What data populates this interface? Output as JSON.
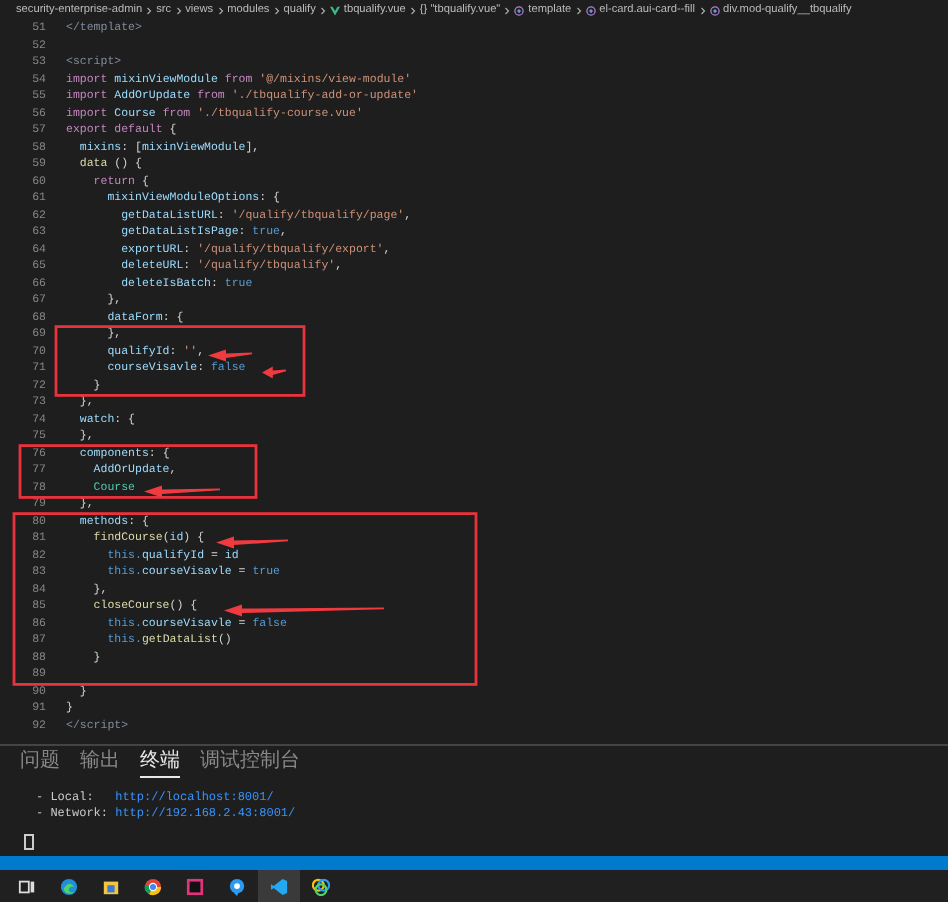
{
  "breadcrumb": [
    {
      "text": "security-enterprise-admin",
      "kind": "folder"
    },
    {
      "text": "src",
      "kind": "folder"
    },
    {
      "text": "views",
      "kind": "folder"
    },
    {
      "text": "modules",
      "kind": "folder"
    },
    {
      "text": "qualify",
      "kind": "folder"
    },
    {
      "text": "tbqualify.vue",
      "kind": "vue-file"
    },
    {
      "text": "{} \"tbqualify.vue\"",
      "kind": "folder"
    },
    {
      "text": "template",
      "kind": "element"
    },
    {
      "text": "el-card.aui-card--fill",
      "kind": "element"
    },
    {
      "text": "div.mod-qualify__tbqualify",
      "kind": "element"
    }
  ],
  "editor": {
    "lines": [
      {
        "number": "51",
        "tokens": [
          {
            "text": "</template>",
            "kind": "tag"
          }
        ]
      },
      {
        "number": "52"
      },
      {
        "number": "53",
        "tokens": [
          {
            "text": "<script>",
            "kind": "tag"
          }
        ]
      },
      {
        "number": "54",
        "tokens": [
          {
            "text": "import",
            "kind": "keyword"
          },
          {
            "text": " mixinViewModule ",
            "kind": "ident"
          },
          {
            "text": "from",
            "kind": "keyword"
          },
          {
            "text": " '@/mixins/view-module'",
            "kind": "string"
          }
        ]
      },
      {
        "number": "55",
        "tokens": [
          {
            "text": "import",
            "kind": "keyword"
          },
          {
            "text": " AddOrUpdate ",
            "kind": "ident"
          },
          {
            "text": "from",
            "kind": "keyword"
          },
          {
            "text": " './tbqualify-add-or-update'",
            "kind": "string"
          }
        ]
      },
      {
        "number": "56",
        "tokens": [
          {
            "text": "import",
            "kind": "keyword"
          },
          {
            "text": " Course ",
            "kind": "ident"
          },
          {
            "text": "from",
            "kind": "keyword"
          },
          {
            "text": " './tbqualify-course.vue'",
            "kind": "string"
          }
        ]
      },
      {
        "number": "57",
        "tokens": [
          {
            "text": "export default",
            "kind": "keyword"
          },
          {
            "text": " {",
            "kind": "punct"
          }
        ]
      },
      {
        "number": "58",
        "tokens": [
          {
            "text": "  mixins",
            "kind": "ident"
          },
          {
            "text": ": [",
            "kind": "punct"
          },
          {
            "text": "mixinViewModule",
            "kind": "ident"
          },
          {
            "text": "],",
            "kind": "punct"
          }
        ]
      },
      {
        "number": "59",
        "tokens": [
          {
            "text": "  data",
            "kind": "func"
          },
          {
            "text": " () {",
            "kind": "punct"
          }
        ]
      },
      {
        "number": "60",
        "tokens": [
          {
            "text": "    return",
            "kind": "keyword"
          },
          {
            "text": " {",
            "kind": "punct"
          }
        ]
      },
      {
        "number": "61",
        "tokens": [
          {
            "text": "      mixinViewModuleOptions",
            "kind": "ident"
          },
          {
            "text": ": {",
            "kind": "punct"
          }
        ]
      },
      {
        "number": "62",
        "tokens": [
          {
            "text": "        getDataListURL",
            "kind": "ident"
          },
          {
            "text": ": ",
            "kind": "punct"
          },
          {
            "text": "'/qualify/tbqualify/page'",
            "kind": "string"
          },
          {
            "text": ",",
            "kind": "punct"
          }
        ]
      },
      {
        "number": "63",
        "tokens": [
          {
            "text": "        getDataListIsPage",
            "kind": "ident"
          },
          {
            "text": ": ",
            "kind": "punct"
          },
          {
            "text": "true",
            "kind": "literal"
          },
          {
            "text": ",",
            "kind": "punct"
          }
        ]
      },
      {
        "number": "64",
        "tokens": [
          {
            "text": "        exportURL",
            "kind": "ident"
          },
          {
            "text": ": ",
            "kind": "punct"
          },
          {
            "text": "'/qualify/tbqualify/export'",
            "kind": "string"
          },
          {
            "text": ",",
            "kind": "punct"
          }
        ]
      },
      {
        "number": "65",
        "tokens": [
          {
            "text": "        deleteURL",
            "kind": "ident"
          },
          {
            "text": ": ",
            "kind": "punct"
          },
          {
            "text": "'/qualify/tbqualify'",
            "kind": "string"
          },
          {
            "text": ",",
            "kind": "punct"
          }
        ]
      },
      {
        "number": "66",
        "tokens": [
          {
            "text": "        deleteIsBatch",
            "kind": "ident"
          },
          {
            "text": ": ",
            "kind": "punct"
          },
          {
            "text": "true",
            "kind": "literal"
          }
        ]
      },
      {
        "number": "67",
        "tokens": [
          {
            "text": "      },",
            "kind": "punct"
          }
        ]
      },
      {
        "number": "68",
        "tokens": [
          {
            "text": "      dataForm",
            "kind": "ident"
          },
          {
            "text": ": {",
            "kind": "punct"
          }
        ]
      },
      {
        "number": "69",
        "tokens": [
          {
            "text": "      },",
            "kind": "punct"
          }
        ]
      },
      {
        "number": "70",
        "tokens": [
          {
            "text": "      qualifyId",
            "kind": "ident"
          },
          {
            "text": ": ",
            "kind": "punct"
          },
          {
            "text": "''",
            "kind": "string"
          },
          {
            "text": ",",
            "kind": "punct"
          }
        ]
      },
      {
        "number": "71",
        "tokens": [
          {
            "text": "      courseVisavle",
            "kind": "ident"
          },
          {
            "text": ": ",
            "kind": "punct"
          },
          {
            "text": "false",
            "kind": "literal"
          }
        ]
      },
      {
        "number": "72",
        "tokens": [
          {
            "text": "    }",
            "kind": "punct"
          }
        ]
      },
      {
        "number": "73",
        "tokens": [
          {
            "text": "  },",
            "kind": "punct"
          }
        ]
      },
      {
        "number": "74",
        "tokens": [
          {
            "text": "  watch",
            "kind": "ident"
          },
          {
            "text": ": {",
            "kind": "punct"
          }
        ]
      },
      {
        "number": "75",
        "tokens": [
          {
            "text": "  },",
            "kind": "punct"
          }
        ]
      },
      {
        "number": "76",
        "tokens": [
          {
            "text": "  components",
            "kind": "ident"
          },
          {
            "text": ": {",
            "kind": "punct"
          }
        ]
      },
      {
        "number": "77",
        "tokens": [
          {
            "text": "    AddOrUpdate",
            "kind": "ident"
          },
          {
            "text": ",",
            "kind": "punct"
          }
        ]
      },
      {
        "number": "78",
        "tokens": [
          {
            "text": "    Course",
            "kind": "class"
          }
        ]
      },
      {
        "number": "79",
        "tokens": [
          {
            "text": "  },",
            "kind": "punct"
          }
        ]
      },
      {
        "number": "80",
        "tokens": [
          {
            "text": "  methods",
            "kind": "ident"
          },
          {
            "text": ": {",
            "kind": "punct"
          }
        ]
      },
      {
        "number": "81",
        "tokens": [
          {
            "text": "    findCourse",
            "kind": "func"
          },
          {
            "text": "(",
            "kind": "punct"
          },
          {
            "text": "id",
            "kind": "ident"
          },
          {
            "text": ") {",
            "kind": "punct"
          }
        ]
      },
      {
        "number": "82",
        "tokens": [
          {
            "text": "      this.",
            "kind": "literal"
          },
          {
            "text": "qualifyId",
            "kind": "ident"
          },
          {
            "text": " = ",
            "kind": "punct"
          },
          {
            "text": "id",
            "kind": "ident"
          }
        ]
      },
      {
        "number": "83",
        "tokens": [
          {
            "text": "      this.",
            "kind": "literal"
          },
          {
            "text": "courseVisavle",
            "kind": "ident"
          },
          {
            "text": " = ",
            "kind": "punct"
          },
          {
            "text": "true",
            "kind": "literal"
          }
        ]
      },
      {
        "number": "84",
        "tokens": [
          {
            "text": "    },",
            "kind": "punct"
          }
        ]
      },
      {
        "number": "85",
        "tokens": [
          {
            "text": "    closeCourse",
            "kind": "func"
          },
          {
            "text": "() {",
            "kind": "punct"
          }
        ]
      },
      {
        "number": "86",
        "tokens": [
          {
            "text": "      this.",
            "kind": "literal"
          },
          {
            "text": "courseVisavle",
            "kind": "ident"
          },
          {
            "text": " = ",
            "kind": "punct"
          },
          {
            "text": "false",
            "kind": "literal"
          }
        ]
      },
      {
        "number": "87",
        "tokens": [
          {
            "text": "      this.",
            "kind": "literal"
          },
          {
            "text": "getDataList",
            "kind": "func"
          },
          {
            "text": "()",
            "kind": "punct"
          }
        ]
      },
      {
        "number": "88",
        "tokens": [
          {
            "text": "    }",
            "kind": "punct"
          }
        ]
      },
      {
        "number": "89"
      },
      {
        "number": "90",
        "tokens": [
          {
            "text": "  }",
            "kind": "punct"
          }
        ]
      },
      {
        "number": "91",
        "tokens": [
          {
            "text": "}",
            "kind": "punct"
          }
        ]
      },
      {
        "number": "92",
        "tokens": [
          {
            "text": "</script>",
            "kind": "tag"
          }
        ]
      }
    ]
  },
  "panel": {
    "tabs": [
      {
        "label": "问题",
        "selected": false
      },
      {
        "label": "输出",
        "selected": false
      },
      {
        "label": "终端",
        "selected": true
      },
      {
        "label": "调试控制台",
        "selected": false
      }
    ],
    "terminal": [
      {
        "label": "- Local:   ",
        "url": "http://localhost:8001/"
      },
      {
        "label": "- Network: ",
        "url": "http://192.168.2.43:8001/"
      }
    ]
  },
  "taskbar": [
    {
      "kind": "task-view",
      "active": false
    },
    {
      "kind": "edge",
      "active": false
    },
    {
      "kind": "folder",
      "active": false
    },
    {
      "kind": "chrome",
      "active": false
    },
    {
      "kind": "jetbrains",
      "active": false
    },
    {
      "kind": "chat",
      "active": false
    },
    {
      "kind": "vscode",
      "active": true
    },
    {
      "kind": "colorful",
      "active": false
    }
  ]
}
